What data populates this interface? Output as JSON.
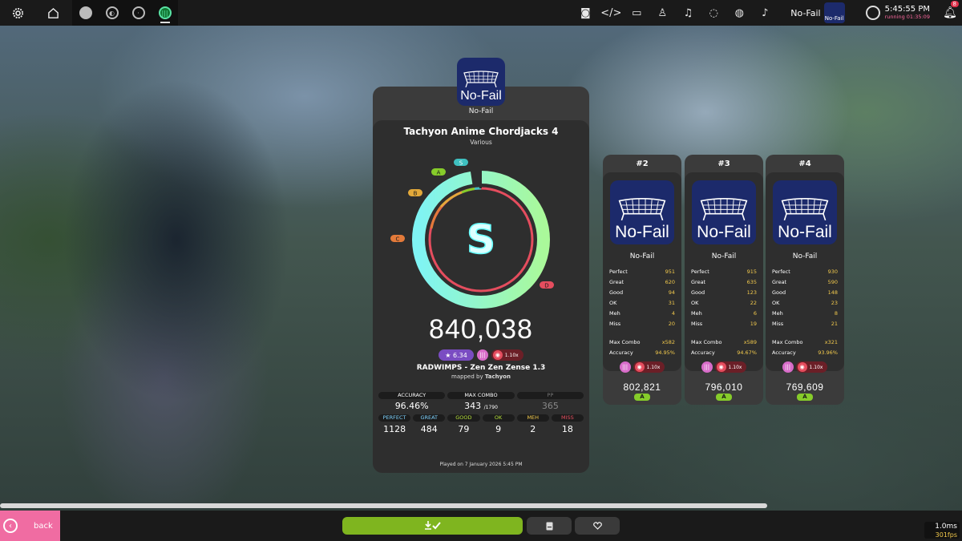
{
  "topbar": {
    "mod_label": "No-Fail",
    "mod_badge": "No-Fail",
    "time": "5:45:55 PM",
    "running": "running 01:35:09",
    "notifications": "8"
  },
  "main": {
    "mod_name": "No-Fail",
    "mod_caption": "No-Fail",
    "title": "Tachyon Anime Chordjacks 4",
    "artist": "Various",
    "grade": "S",
    "grade_markers": [
      "S",
      "A",
      "B",
      "C",
      "D"
    ],
    "score": "840,038",
    "stars": "★ 6.34",
    "rate": "1.10x",
    "beatmap": "RADWIMPS - Zen Zen Zense 1.3",
    "mapped_by": "mapped by",
    "mapper": "Tachyon",
    "accuracy_label": "ACCURACY",
    "accuracy": "96.46%",
    "max_combo_label": "MAX COMBO",
    "max_combo": "343",
    "max_combo_total": "/1790",
    "pp_label": "PP",
    "pp": "365",
    "judgements": [
      {
        "label": "PERFECT",
        "value": "1128",
        "color": "#7fd3ff"
      },
      {
        "label": "GREAT",
        "value": "484",
        "color": "#7fd3ff"
      },
      {
        "label": "GOOD",
        "value": "79",
        "color": "#b6e03a"
      },
      {
        "label": "OK",
        "value": "9",
        "color": "#b6e03a"
      },
      {
        "label": "MEH",
        "value": "2",
        "color": "#f2c94c"
      },
      {
        "label": "MISS",
        "value": "18",
        "color": "#e54d5e"
      }
    ],
    "played_on": "Played on 7 January 2026 5:45 PM",
    "accuracy_fraction": 0.9646
  },
  "side_cards": [
    {
      "rank": "#2",
      "mod_name": "No-Fail",
      "mod_caption": "No-Fail",
      "stats": [
        [
          "Perfect",
          "951"
        ],
        [
          "Great",
          "620"
        ],
        [
          "Good",
          "94"
        ],
        [
          "OK",
          "31"
        ],
        [
          "Meh",
          "4"
        ],
        [
          "Miss",
          "20"
        ]
      ],
      "max_combo_label": "Max Combo",
      "max_combo": "x582",
      "accuracy_label": "Accuracy",
      "accuracy": "94.95%",
      "rate": "1.10x",
      "score": "802,821",
      "grade": "A"
    },
    {
      "rank": "#3",
      "mod_name": "No-Fail",
      "mod_caption": "No-Fail",
      "stats": [
        [
          "Perfect",
          "915"
        ],
        [
          "Great",
          "635"
        ],
        [
          "Good",
          "123"
        ],
        [
          "OK",
          "22"
        ],
        [
          "Meh",
          "6"
        ],
        [
          "Miss",
          "19"
        ]
      ],
      "max_combo_label": "Max Combo",
      "max_combo": "x589",
      "accuracy_label": "Accuracy",
      "accuracy": "94.67%",
      "rate": "1.10x",
      "score": "796,010",
      "grade": "A"
    },
    {
      "rank": "#4",
      "mod_name": "No-Fail",
      "mod_caption": "No-Fail",
      "stats": [
        [
          "Perfect",
          "930"
        ],
        [
          "Great",
          "590"
        ],
        [
          "Good",
          "148"
        ],
        [
          "OK",
          "23"
        ],
        [
          "Meh",
          "8"
        ],
        [
          "Miss",
          "21"
        ]
      ],
      "max_combo_label": "Max Combo",
      "max_combo": "x321",
      "accuracy_label": "Accuracy",
      "accuracy": "93.96%",
      "rate": "1.10x",
      "score": "769,609",
      "grade": "A"
    }
  ],
  "bottombar": {
    "back_label": "back",
    "frame_time": "1.0ms",
    "fps": "301fps"
  },
  "icons": {
    "settings": "gear-icon",
    "home": "home-icon",
    "download": "download-check-icon",
    "beatmap": "beatmap-icon",
    "favourite": "heart-icon"
  },
  "colors": {
    "accent_green": "#7fb51f",
    "back_pink": "#f06ca2",
    "ring_cyan": "#7ff4f4",
    "ring_green": "#aaf99a",
    "grade_a": "#86cc2a",
    "stat_yellow": "#f2c94c"
  }
}
